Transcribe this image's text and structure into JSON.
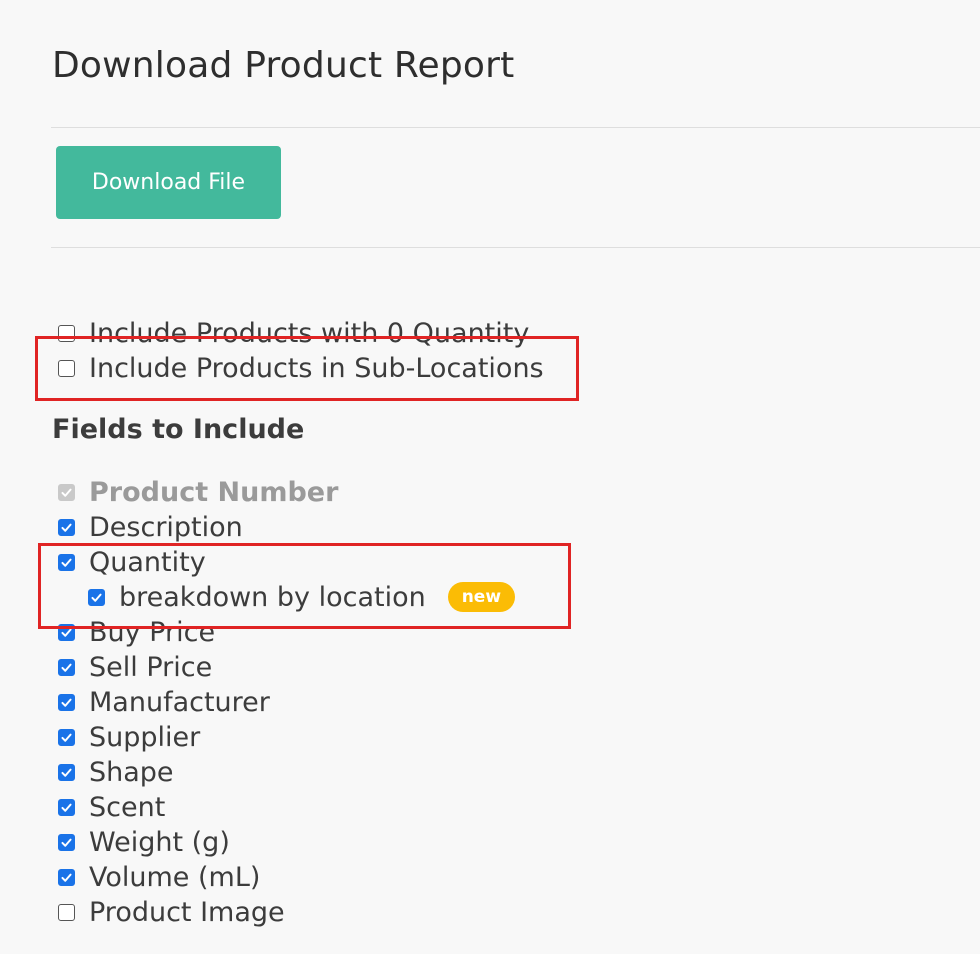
{
  "page": {
    "title": "Download Product Report"
  },
  "actions": {
    "download_label": "Download File"
  },
  "options": [
    {
      "label": "Include Products with 0 Quantity",
      "checked": false
    },
    {
      "label": "Include Products in Sub-Locations",
      "checked": false
    }
  ],
  "fields_section": {
    "heading": "Fields to Include",
    "badge_new": "new",
    "fields": [
      {
        "label": "Product Number",
        "checked": true,
        "disabled": true
      },
      {
        "label": "Description",
        "checked": true
      },
      {
        "label": "Quantity",
        "checked": true
      },
      {
        "label": "breakdown by location",
        "checked": true
      },
      {
        "label": "Buy Price",
        "checked": true
      },
      {
        "label": "Sell Price",
        "checked": true
      },
      {
        "label": "Manufacturer",
        "checked": true
      },
      {
        "label": "Supplier",
        "checked": true
      },
      {
        "label": "Shape",
        "checked": true
      },
      {
        "label": "Scent",
        "checked": true
      },
      {
        "label": "Weight (g)",
        "checked": true
      },
      {
        "label": "Volume (mL)",
        "checked": true
      },
      {
        "label": "Product Image",
        "checked": false
      }
    ]
  },
  "colors": {
    "primary_button": "#43b99c",
    "checkbox_checked": "#1a73e8",
    "badge": "#fbbc05",
    "highlight": "#e02424"
  },
  "icons": {
    "checkmark": "checkmark-icon"
  }
}
